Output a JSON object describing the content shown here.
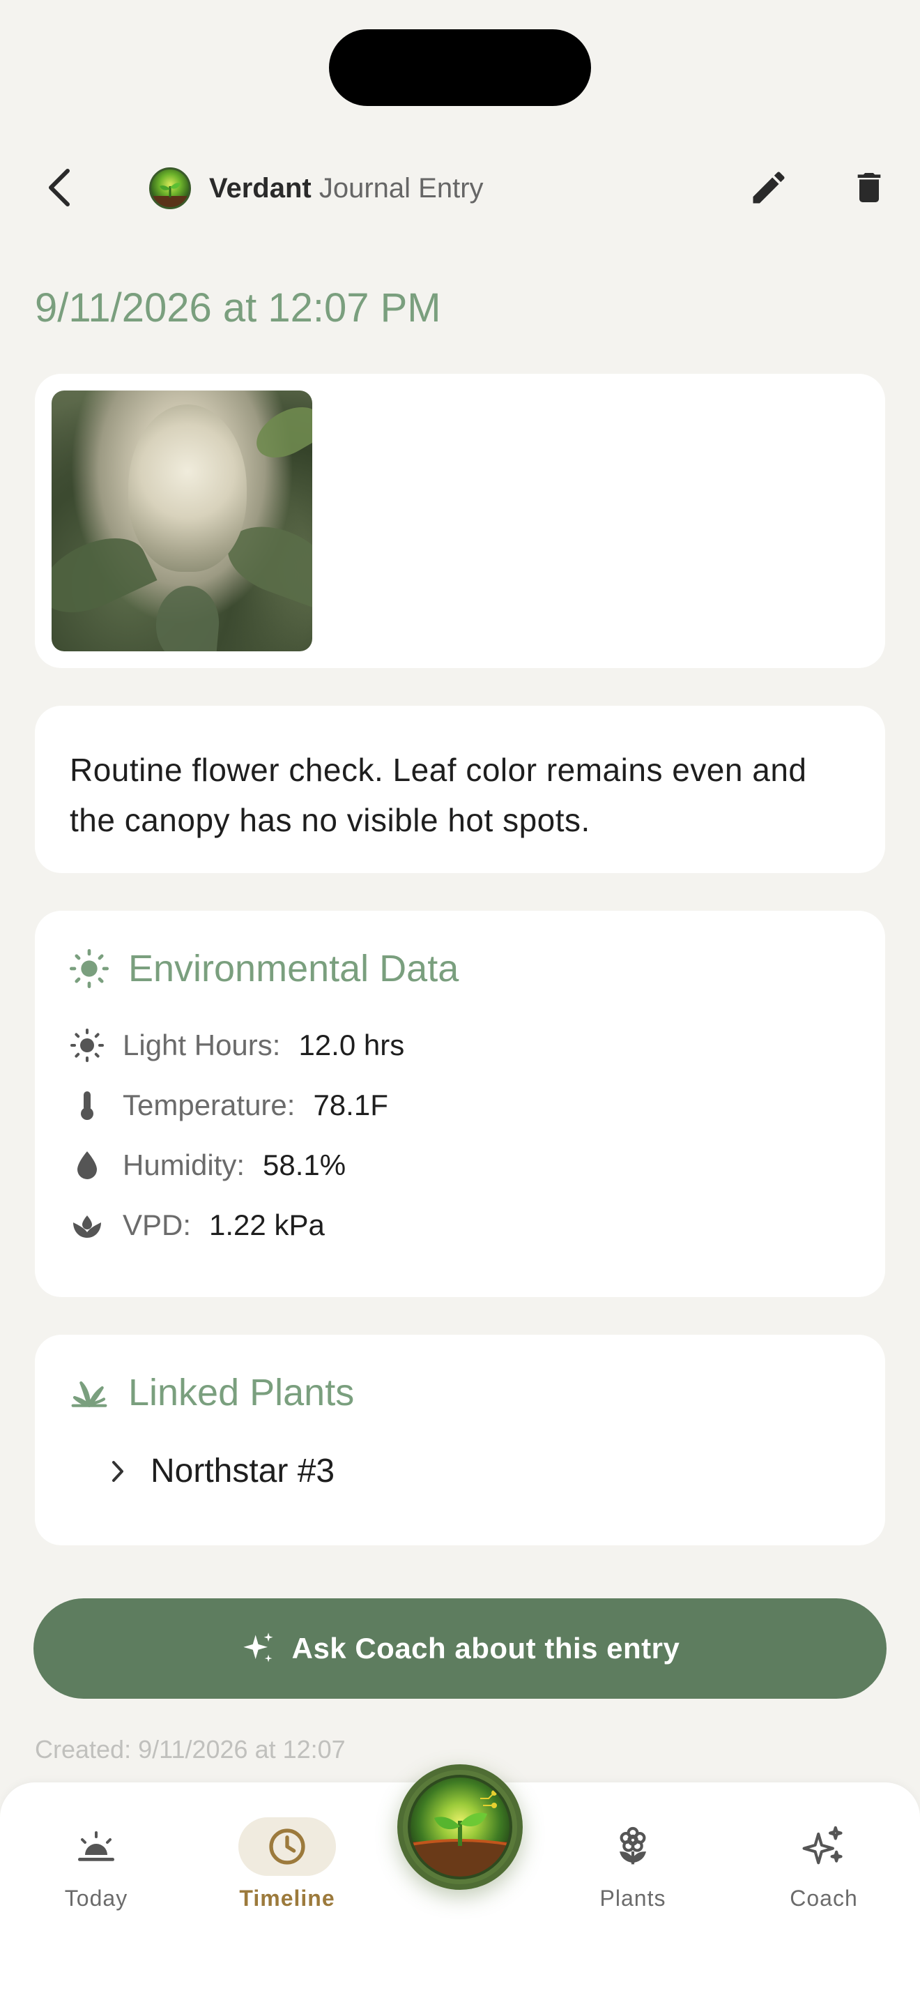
{
  "header": {
    "brand": "Verdant",
    "title_rest": "Journal Entry"
  },
  "entry": {
    "datetime": "9/11/2026 at 12:07 PM",
    "notes": "Routine flower check. Leaf color remains even and the canopy has no visible hot spots.",
    "created": "Created: 9/11/2026 at 12:07"
  },
  "environment": {
    "title": "Environmental Data",
    "rows": [
      {
        "icon": "sun-icon",
        "label": "Light Hours:",
        "value": "12.0 hrs"
      },
      {
        "icon": "thermometer-icon",
        "label": "Temperature:",
        "value": "78.1F"
      },
      {
        "icon": "droplet-icon",
        "label": "Humidity:",
        "value": "58.1%"
      },
      {
        "icon": "leaf-drop-icon",
        "label": "VPD:",
        "value": "1.22 kPa"
      }
    ]
  },
  "linked_plants": {
    "title": "Linked Plants",
    "items": [
      {
        "name": "Northstar #3"
      }
    ]
  },
  "coach_button": {
    "label": "Ask Coach about this entry"
  },
  "tabs": [
    {
      "label": "Today",
      "icon": "sunrise-icon",
      "active": false
    },
    {
      "label": "Timeline",
      "icon": "clock-icon",
      "active": true
    },
    {
      "label": "Plants",
      "icon": "flower-icon",
      "active": false
    },
    {
      "label": "Coach",
      "icon": "sparkles-icon",
      "active": false
    }
  ],
  "colors": {
    "accent_green": "#7a9f7e",
    "button_green": "#5e7d5f",
    "active_tab": "#9c7a3c",
    "background": "#f4f3ef"
  }
}
